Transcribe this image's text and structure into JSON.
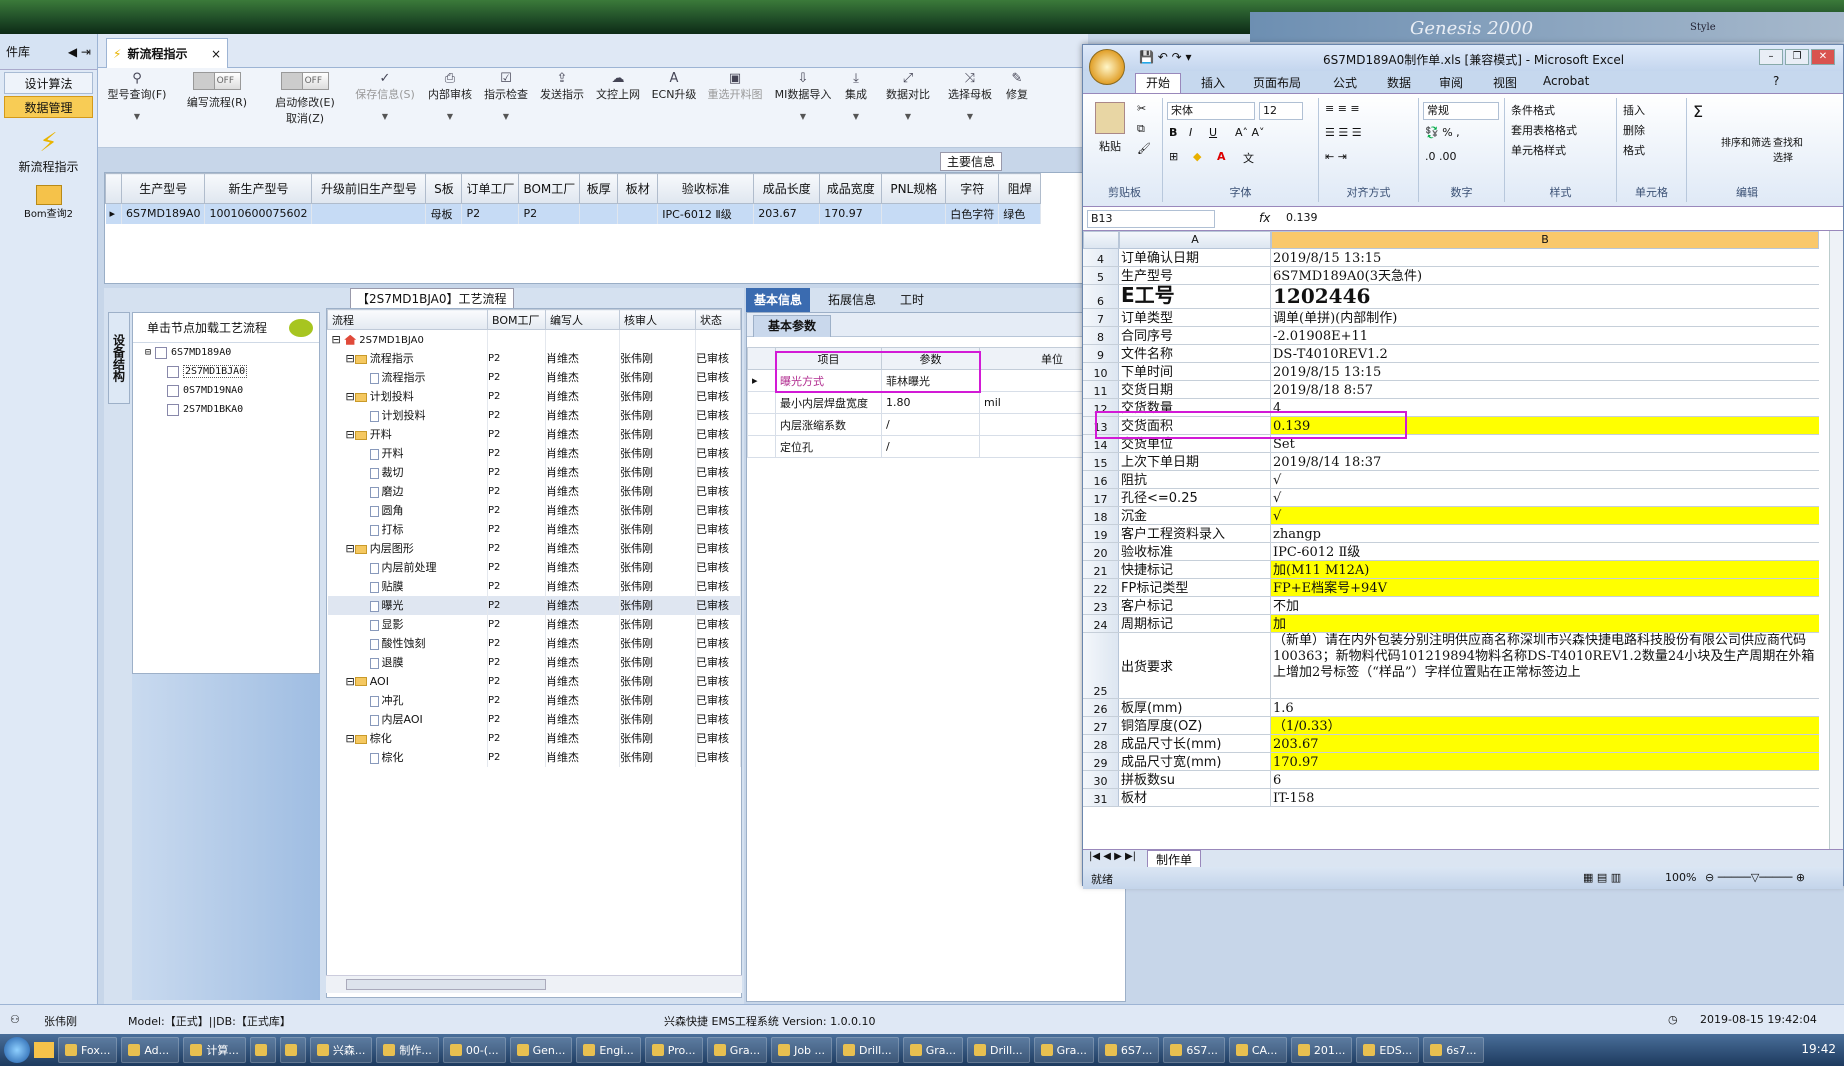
{
  "top_bg": {
    "t1": "Genesis 2000",
    "t2": "Style"
  },
  "leftnav": {
    "title": "件库",
    "items": [
      "设计算法",
      "数据管理"
    ],
    "icons": [
      {
        "label": "新流程指示"
      },
      {
        "label": "Bom查询2"
      }
    ]
  },
  "tab": {
    "label": "新流程指示"
  },
  "toolbar": {
    "model_query": "型号查询(F)",
    "write_flow": "编写流程(R)",
    "start_modify": "启动修改(E)",
    "cancel": "取消(Z)",
    "save_info": "保存信息(S)",
    "toggle_off": "OFF",
    "buttons": [
      "内部审核",
      "指示检查",
      "发送指示",
      "文控上网",
      "ECN升级",
      "重选开料图",
      "MI数据导入",
      "集成",
      "数据对比",
      "选择母板",
      "修复"
    ]
  },
  "main_info_label": "主要信息",
  "grid1": {
    "headers": [
      "生产型号",
      "新生产型号",
      "升级前旧生产型号",
      "S板",
      "订单工厂",
      "BOM工厂",
      "板厚",
      "板材",
      "验收标准",
      "成品长度",
      "成品宽度",
      "PNL规格",
      "字符",
      "阻焊"
    ],
    "row": [
      "6S7MD189A0",
      "10010600075602",
      "",
      "母板",
      "P2",
      "P2",
      "",
      "",
      "IPC-6012 Ⅱ级",
      "203.67",
      "170.97",
      "",
      "白色字符",
      "绿色"
    ]
  },
  "left_tree": {
    "vtab": "设备结构",
    "header": "单击节点加载工艺流程",
    "root": "6S7MD189A0",
    "children": [
      "2S7MD1BJA0",
      "0S7MD19NA0",
      "2S7MD1BKA0"
    ]
  },
  "process": {
    "title": "【2S7MD1BJA0】工艺流程",
    "headers": [
      "流程",
      "BOM工厂",
      "编写人",
      "核审人",
      "状态"
    ],
    "root": "2S7MD1BJA0",
    "rows": [
      {
        "name": "流程指示",
        "level": 1,
        "folder": true
      },
      {
        "name": "流程指示",
        "level": 2,
        "folder": false
      },
      {
        "name": "计划投料",
        "level": 1,
        "folder": true
      },
      {
        "name": "计划投料",
        "level": 2,
        "folder": false
      },
      {
        "name": "开料",
        "level": 1,
        "folder": true
      },
      {
        "name": "开料",
        "level": 2,
        "folder": false
      },
      {
        "name": "裁切",
        "level": 2,
        "folder": false
      },
      {
        "name": "磨边",
        "level": 2,
        "folder": false
      },
      {
        "name": "圆角",
        "level": 2,
        "folder": false
      },
      {
        "name": "打标",
        "level": 2,
        "folder": false
      },
      {
        "name": "内层图形",
        "level": 1,
        "folder": true
      },
      {
        "name": "内层前处理",
        "level": 2,
        "folder": false
      },
      {
        "name": "贴膜",
        "level": 2,
        "folder": false
      },
      {
        "name": "曝光",
        "level": 2,
        "folder": false,
        "selected": true
      },
      {
        "name": "显影",
        "level": 2,
        "folder": false
      },
      {
        "name": "酸性蚀刻",
        "level": 2,
        "folder": false
      },
      {
        "name": "退膜",
        "level": 2,
        "folder": false
      },
      {
        "name": "AOI",
        "level": 1,
        "folder": true
      },
      {
        "name": "冲孔",
        "level": 2,
        "folder": false
      },
      {
        "name": "内层AOI",
        "level": 2,
        "folder": false
      },
      {
        "name": "棕化",
        "level": 1,
        "folder": true
      },
      {
        "name": "棕化",
        "level": 2,
        "folder": false
      }
    ],
    "bom": "P2",
    "writer": "肖维杰",
    "reviewer": "张伟刚",
    "status": "已审核"
  },
  "info": {
    "tabs": [
      "基本信息",
      "拓展信息",
      "工时"
    ],
    "subtab": "基本参数",
    "headers": [
      "项目",
      "参数",
      "单位"
    ],
    "rows": [
      {
        "item": "曝光方式",
        "param": "菲林曝光",
        "unit": ""
      },
      {
        "item": "最小内层焊盘宽度",
        "param": "1.80",
        "unit": "mil"
      },
      {
        "item": "内层涨缩系数",
        "param": "/",
        "unit": ""
      },
      {
        "item": "定位孔",
        "param": "/",
        "unit": ""
      }
    ]
  },
  "status": {
    "user": "张伟刚",
    "model": "Model:【正式】||DB:【正式库】",
    "system": "兴森快捷 EMS工程系统 Version: 1.0.0.10",
    "datetime": "2019-08-15 19:42:04"
  },
  "taskbar": {
    "items": [
      "Fox...",
      "Ad...",
      "计算...",
      "",
      "",
      "兴森...",
      "制作...",
      "00-(...",
      "Gen...",
      "Engi...",
      "Pro...",
      "Gra...",
      "Job ...",
      "Drill...",
      "Gra...",
      "Drill...",
      "Gra...",
      "6S7...",
      "6S7...",
      "CA...",
      "201...",
      "EDS...",
      "6s7..."
    ],
    "time": "19:42"
  },
  "excel": {
    "title": "6S7MD189A0制作单.xls [兼容模式] - Microsoft Excel",
    "tabs": [
      "开始",
      "插入",
      "页面布局",
      "公式",
      "数据",
      "审阅",
      "视图",
      "Acrobat"
    ],
    "ribbon": {
      "paste": "粘贴",
      "clipboard": "剪贴板",
      "font_name": "宋体",
      "font_size": "12",
      "font": "字体",
      "align": "对齐方式",
      "number_fmt": "常规",
      "number": "数字",
      "cond": "条件格式",
      "table": "套用表格格式",
      "cellstyle": "单元格样式",
      "style": "样式",
      "insert": "插入",
      "delete": "删除",
      "format": "格式",
      "cells": "单元格",
      "sort": "排序和筛选",
      "find": "查找和选择",
      "edit": "编辑"
    },
    "namebox": "B13",
    "formula": "0.139",
    "cols": [
      "A",
      "B"
    ],
    "rows": [
      {
        "n": "4",
        "a": "订单确认日期",
        "b": "2019/8/15 13:15",
        "y": false
      },
      {
        "n": "5",
        "a": "生产型号",
        "b": "6S7MD189A0(3天急件)",
        "y": false
      },
      {
        "n": "6",
        "a": "E工号",
        "b": "1202446",
        "y": false,
        "big": true
      },
      {
        "n": "7",
        "a": "订单类型",
        "b": "调单(单拼)(内部制作)",
        "y": false
      },
      {
        "n": "8",
        "a": "合同序号",
        "b": "-2.01908E+11",
        "y": false
      },
      {
        "n": "9",
        "a": "文件名称",
        "b": "DS-T4010REV1.2",
        "y": false
      },
      {
        "n": "10",
        "a": "下单时间",
        "b": "2019/8/15 13:15",
        "y": false
      },
      {
        "n": "11",
        "a": "交货日期",
        "b": "2019/8/18 8:57",
        "y": false
      },
      {
        "n": "12",
        "a": "交货数量",
        "b": "4",
        "y": false
      },
      {
        "n": "13",
        "a": "交货面积",
        "b": "0.139",
        "y": true
      },
      {
        "n": "14",
        "a": "交货单位",
        "b": "Set",
        "y": false
      },
      {
        "n": "15",
        "a": "上次下单日期",
        "b": "2019/8/14 18:37",
        "y": false
      },
      {
        "n": "16",
        "a": "阻抗",
        "b": "√",
        "y": false
      },
      {
        "n": "17",
        "a": "孔径<=0.25",
        "b": "√",
        "y": false
      },
      {
        "n": "18",
        "a": "沉金",
        "b": "√",
        "y": true
      },
      {
        "n": "19",
        "a": "客户工程资料录入",
        "b": "zhangp",
        "y": false
      },
      {
        "n": "20",
        "a": "验收标准",
        "b": "IPC-6012 Ⅱ级",
        "y": false
      },
      {
        "n": "21",
        "a": "快捷标记",
        "b": "加(M11 M12A)",
        "y": true
      },
      {
        "n": "22",
        "a": "FP标记类型",
        "b": "FP+E档案号+94V",
        "y": true
      },
      {
        "n": "23",
        "a": "客户标记",
        "b": "不加",
        "y": false
      },
      {
        "n": "24",
        "a": "周期标记",
        "b": "加",
        "y": true
      },
      {
        "n": "25",
        "a": "出货要求",
        "b": "（新单）请在内外包装分别注明供应商名称深圳市兴森快捷电路科技股份有限公司供应商代码100363；新物料代码101219894物料名称DS-T4010REV1.2数量24小块及生产周期在外箱上增加2号标签（“样品”）字样位置贴在正常标签边上",
        "y": false,
        "tall": true
      },
      {
        "n": "26",
        "a": "板厚(mm)",
        "b": "1.6",
        "y": false
      },
      {
        "n": "27",
        "a": "铜箔厚度(OZ)",
        "b": "（1/0.33）",
        "y": true
      },
      {
        "n": "28",
        "a": "成品尺寸长(mm)",
        "b": "203.67",
        "y": true
      },
      {
        "n": "29",
        "a": "成品尺寸宽(mm)",
        "b": "170.97",
        "y": true
      },
      {
        "n": "30",
        "a": "拼板数su",
        "b": "6",
        "y": false
      },
      {
        "n": "31",
        "a": "板材",
        "b": "IT-158",
        "y": false
      }
    ],
    "sheet_tab": "制作单",
    "ready": "就绪",
    "zoom": "100%"
  },
  "colors": {
    "highlight": "#ffff00",
    "magenta": "#d21ad6",
    "accent": "#3a6bb0"
  }
}
